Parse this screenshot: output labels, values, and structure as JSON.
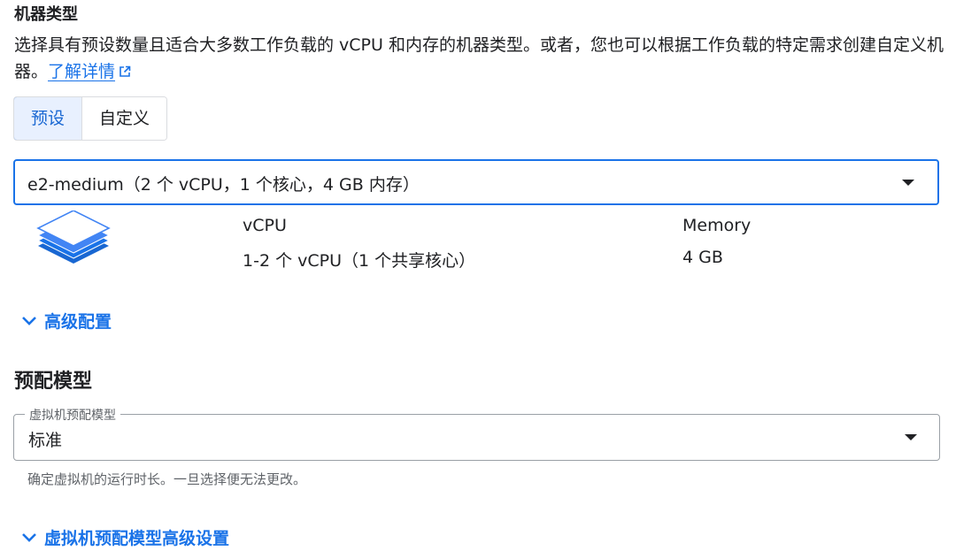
{
  "machine_type": {
    "title": "机器类型",
    "description": "选择具有预设数量且适合大多数工作负载的 vCPU 和内存的机器类型。或者，您也可以根据工作负载的特定需求创建自定义机器。",
    "learn_more": "了解详情",
    "tabs": [
      {
        "label": "预设",
        "active": true
      },
      {
        "label": "自定义",
        "active": false
      }
    ],
    "selected": "e2-medium（2 个 vCPU，1 个核心，4 GB 内存）",
    "specs": {
      "vcpu_label": "vCPU",
      "vcpu_value": "1-2 个 vCPU（1 个共享核心）",
      "memory_label": "Memory",
      "memory_value": "4 GB"
    },
    "advanced_label": "高级配置",
    "icon": "layers-stack-icon"
  },
  "provisioning": {
    "title": "预配模型",
    "field_label": "虚拟机预配模型",
    "value": "标准",
    "hint": "确定虚拟机的运行时长。一旦选择便无法更改。",
    "advanced_label": "虚拟机预配模型高级设置"
  },
  "colors": {
    "accent": "#1a73e8",
    "active_tab_bg": "#e8f0fe",
    "text": "#202124",
    "secondary_text": "#5f6368",
    "border": "#dadce0"
  }
}
